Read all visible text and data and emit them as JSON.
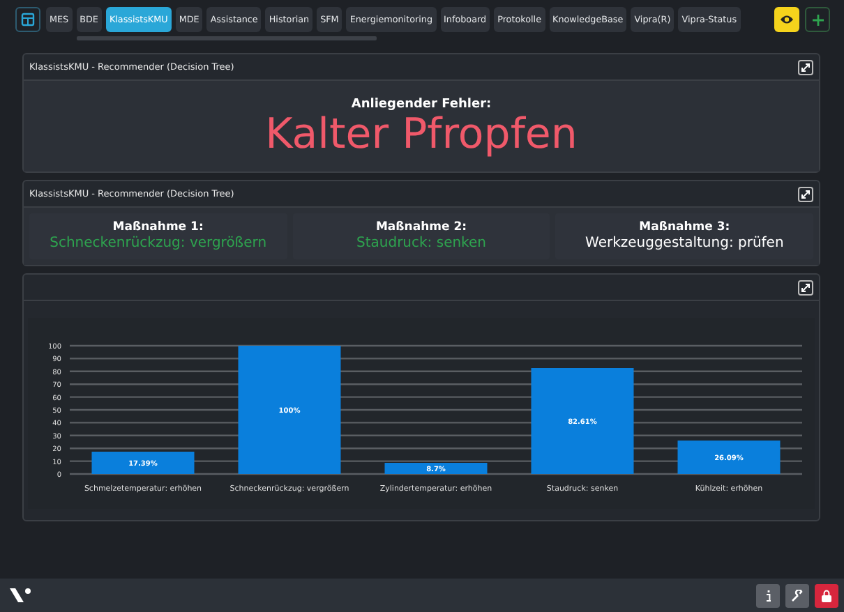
{
  "tabs": [
    {
      "label": "MES",
      "selected": false
    },
    {
      "label": "BDE",
      "selected": false
    },
    {
      "label": "KlassistsKMU",
      "selected": true
    },
    {
      "label": "MDE",
      "selected": false
    },
    {
      "label": "Assistance",
      "selected": false
    },
    {
      "label": "Historian",
      "selected": false
    },
    {
      "label": "SFM",
      "selected": false
    },
    {
      "label": "Energiemonitoring",
      "selected": false
    },
    {
      "label": "Infoboard",
      "selected": false
    },
    {
      "label": "Protokolle",
      "selected": false
    },
    {
      "label": "KnowledgeBase",
      "selected": false
    },
    {
      "label": "Vipra(R)",
      "selected": false
    },
    {
      "label": "Vipra-Status",
      "selected": false
    }
  ],
  "fault_panel": {
    "title": "KlassistsKMU - Recommender (Decision Tree)",
    "label": "Anliegender Fehler:",
    "fault": "Kalter Pfropfen"
  },
  "measures_panel": {
    "title": "KlassistsKMU - Recommender (Decision Tree)",
    "measures": [
      {
        "label": "Maßnahme 1:",
        "action": "Schneckenrückzug: vergrößern",
        "color": "#2ea44f"
      },
      {
        "label": "Maßnahme 2:",
        "action": "Staudruck: senken",
        "color": "#2ea44f"
      },
      {
        "label": "Maßnahme 3:",
        "action": "Werkzeuggestaltung: prüfen",
        "color": "#ffffff"
      }
    ]
  },
  "chart_panel": {
    "chart_data": {
      "type": "bar",
      "categories": [
        "Schmelzetemperatur: erhöhen",
        "Schneckenrückzug: vergrößern",
        "Zylindertemperatur: erhöhen",
        "Staudruck: senken",
        "Kühlzeit: erhöhen"
      ],
      "grid": true,
      "series": [
        {
          "color": "#0a7fdc",
          "values": [
            17.39,
            100,
            8.7,
            82.61,
            26.09
          ]
        }
      ],
      "value_labels": [
        "17.39%",
        "100%",
        "8.7%",
        "82.61%",
        "26.09%"
      ],
      "ylim": [
        0,
        100
      ],
      "yticks": [
        0,
        10,
        20,
        30,
        40,
        50,
        60,
        70,
        80,
        90,
        100
      ]
    }
  }
}
